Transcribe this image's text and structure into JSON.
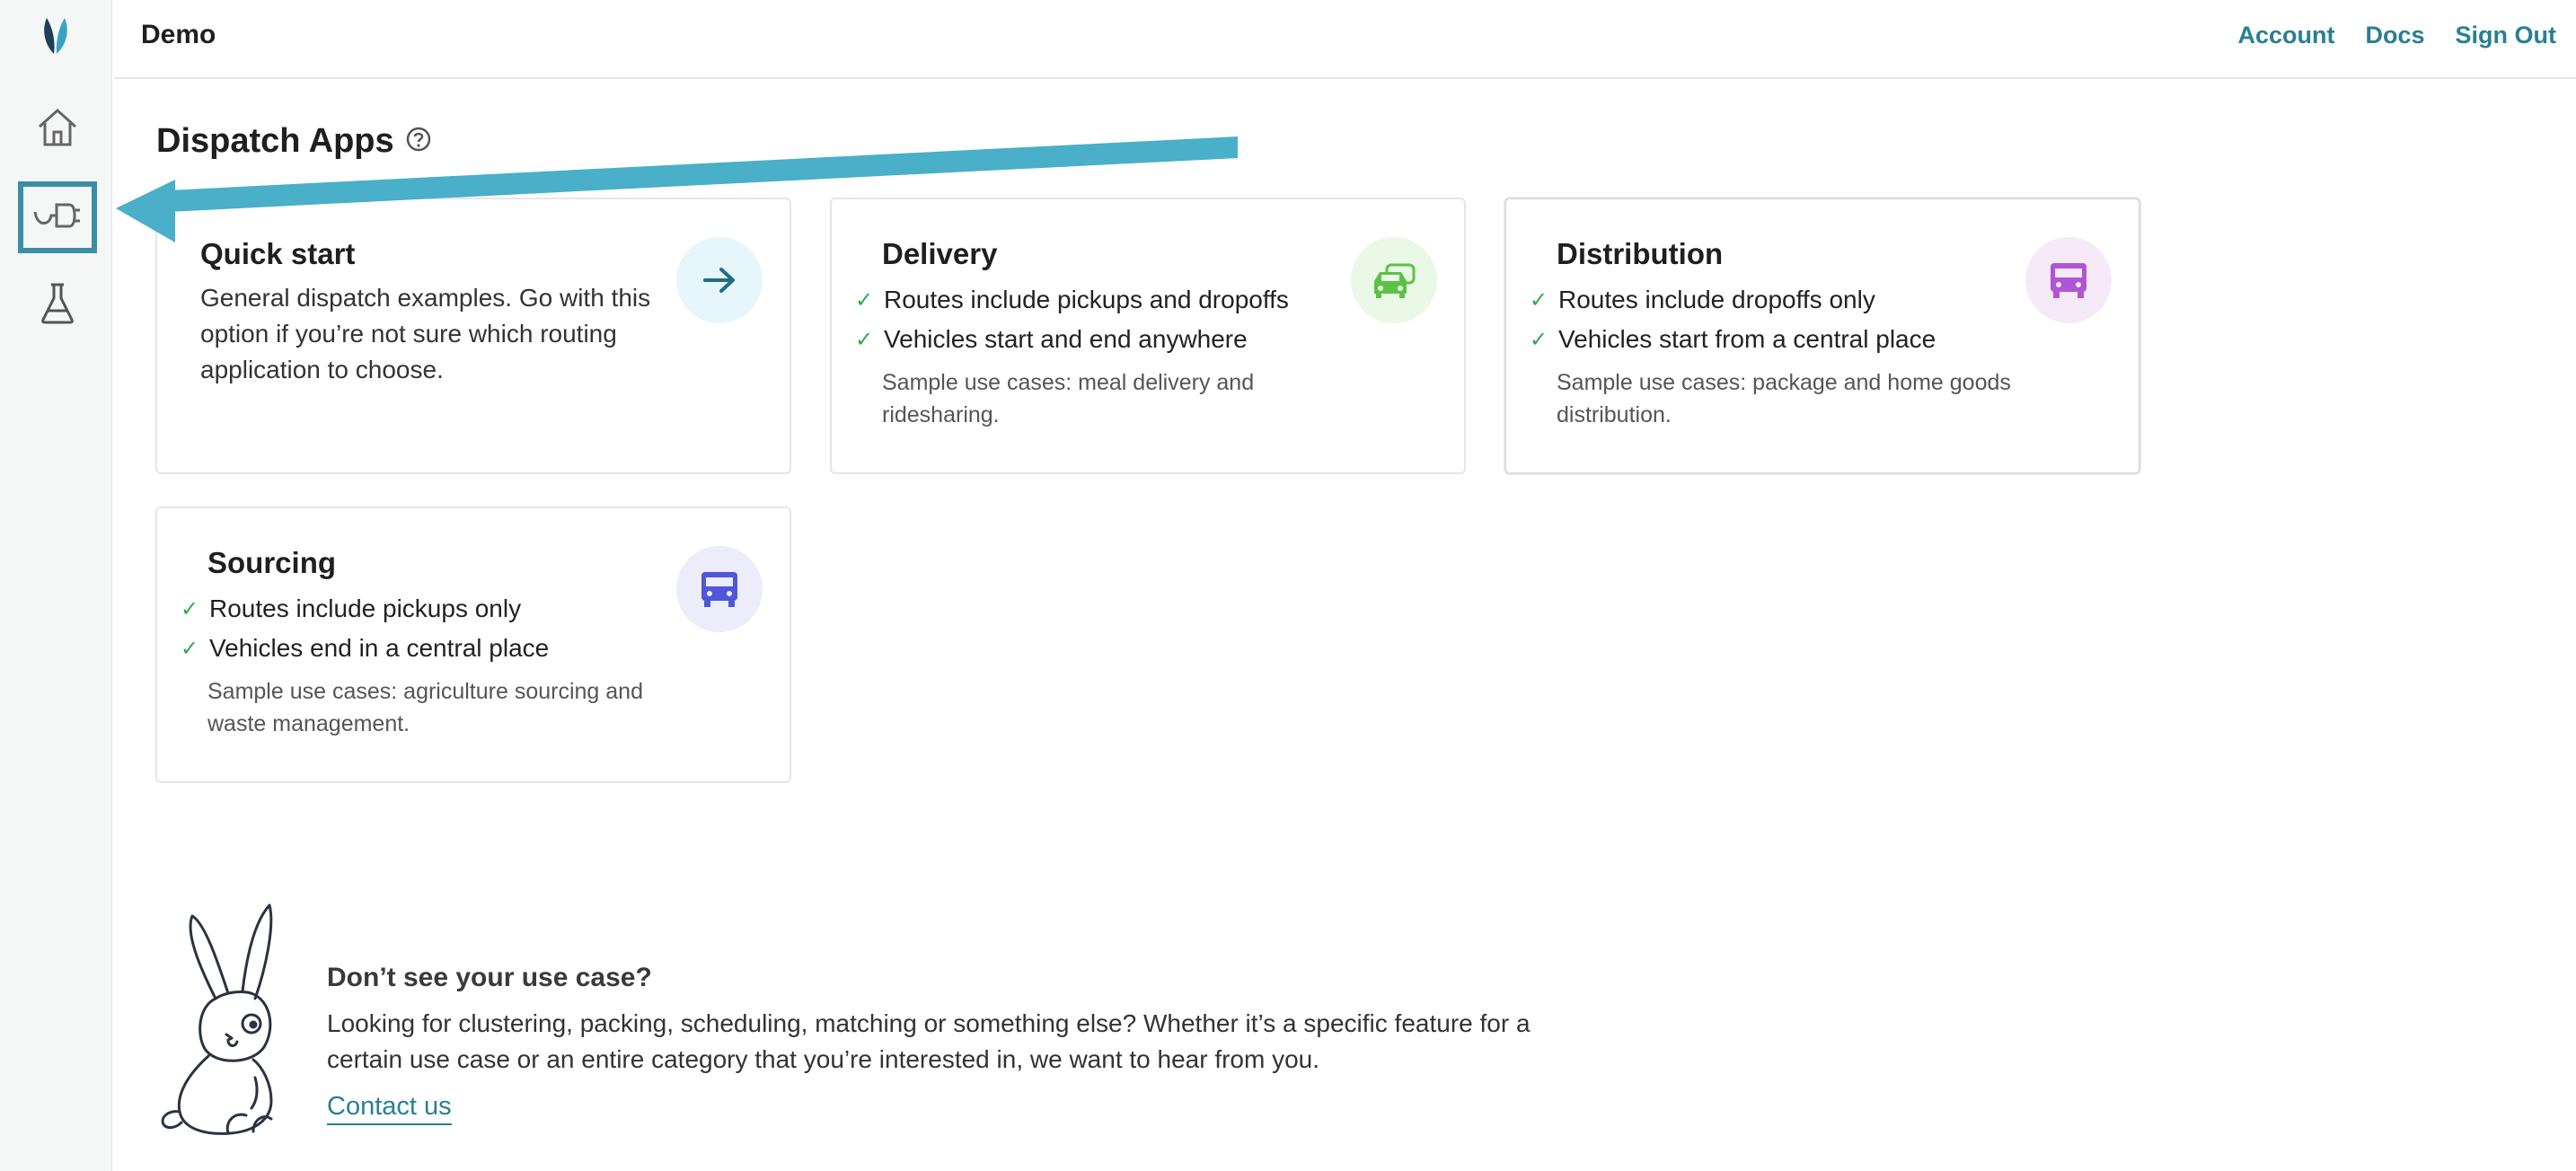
{
  "header": {
    "app_title": "Demo",
    "nav": [
      "Account",
      "Docs",
      "Sign Out"
    ]
  },
  "sidebar": {
    "items": [
      {
        "name": "home-icon",
        "active": false
      },
      {
        "name": "plug-icon",
        "active": true
      },
      {
        "name": "flask-icon",
        "active": false
      }
    ]
  },
  "main": {
    "title": "Dispatch Apps",
    "cards": [
      {
        "title": "Quick start",
        "description": "General dispatch examples. Go with this option if you’re not sure which routing application to choose.",
        "icon": "arrow-right-icon",
        "icon_color": "#1f6f83",
        "icon_bg": "#e6f6fb"
      },
      {
        "title": "Delivery",
        "bullets": [
          "Routes include pickups and dropoffs",
          "Vehicles start and end anywhere"
        ],
        "sample": "Sample use cases: meal delivery and ridesharing.",
        "icon": "cars-icon",
        "icon_color": "#5cc247",
        "icon_bg": "#eaf8e6"
      },
      {
        "title": "Distribution",
        "bullets": [
          "Routes include dropoffs only",
          "Vehicles start from a central place"
        ],
        "sample": "Sample use cases: package and home goods distribution.",
        "icon": "truck-icon",
        "icon_color": "#b055d6",
        "icon_bg": "#f6eaf9"
      },
      {
        "title": "Sourcing",
        "bullets": [
          "Routes include pickups only",
          "Vehicles end in a central place"
        ],
        "sample": "Sample use cases: agriculture sourcing and waste management.",
        "icon": "truck-icon",
        "icon_color": "#4f57d9",
        "icon_bg": "#ececfb"
      }
    ]
  },
  "cta": {
    "title": "Don’t see your use case?",
    "body": "Looking for clustering, packing, scheduling, matching or something else? Whether it’s a specific feature for a certain use case or an entire category that you’re interested in, we want to hear from you.",
    "link": "Contact us"
  },
  "colors": {
    "accent": "#2a7f92",
    "annotation_arrow": "#4aafc8",
    "check": "#33a852"
  }
}
